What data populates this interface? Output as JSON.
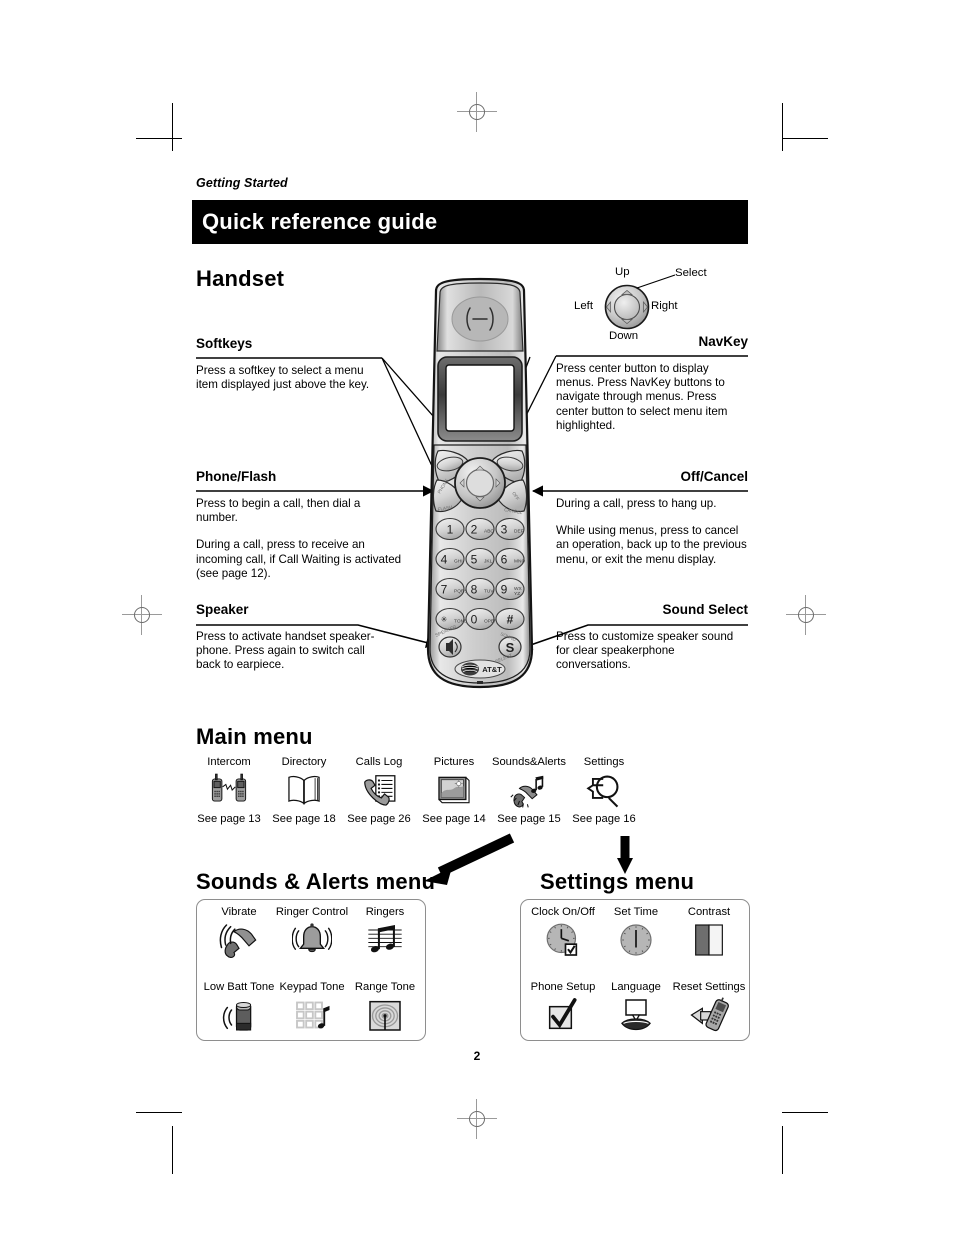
{
  "page": {
    "running_head": "Getting Started",
    "title": "Quick reference guide",
    "folio": "2"
  },
  "sections": {
    "handset_title": "Handset",
    "main_menu_title": "Main menu",
    "sounds_menu_title": "Sounds & Alerts menu",
    "settings_menu_title": "Settings menu"
  },
  "navkey": {
    "up": "Up",
    "down": "Down",
    "left": "Left",
    "right": "Right",
    "select": "Select",
    "name": "NavKey"
  },
  "callouts": {
    "softkeys": {
      "heading": "Softkeys",
      "p1": "Press a softkey to select a menu item displayed just above the key."
    },
    "navkey": {
      "heading": "NavKey",
      "p1": "Press center button to display menus. Press NavKey buttons to navigate through menus. Press center button to select menu item highlighted."
    },
    "phone_flash": {
      "heading": "Phone/Flash",
      "p1": "Press to begin a call, then dial a number.",
      "p2": "During a call, press to receive an incoming call, if Call Waiting is activated (see page 12)."
    },
    "off_cancel": {
      "heading": "Off/Cancel",
      "p1": "During a call, press to hang up.",
      "p2": "While using menus, press to cancel an operation, back up to the previous menu, or exit the menu display."
    },
    "speaker": {
      "heading": "Speaker",
      "p1": "Press to activate handset speaker-phone. Press again to switch call back to earpiece."
    },
    "sound_select": {
      "heading": "Sound Select",
      "p1": "Press to customize speaker sound for clear speakerphone conversations."
    }
  },
  "main_menu_items": [
    {
      "label": "Intercom",
      "ref": "See page 13",
      "icon": "intercom-icon"
    },
    {
      "label": "Directory",
      "ref": "See page 18",
      "icon": "directory-icon"
    },
    {
      "label": "Calls Log",
      "ref": "See page 26",
      "icon": "calls-log-icon"
    },
    {
      "label": "Pictures",
      "ref": "See page 14",
      "icon": "pictures-icon"
    },
    {
      "label": "Sounds&Alerts",
      "ref": "See page 15",
      "icon": "sounds-alerts-icon"
    },
    {
      "label": "Settings",
      "ref": "See page 16",
      "icon": "settings-icon"
    }
  ],
  "sounds_menu_items": [
    {
      "label": "Vibrate",
      "icon": "vibrate-icon"
    },
    {
      "label": "Ringer Control",
      "icon": "ringer-control-icon"
    },
    {
      "label": "Ringers",
      "icon": "ringers-icon"
    },
    {
      "label": "Low Batt Tone",
      "icon": "low-battery-tone-icon"
    },
    {
      "label": "Keypad Tone",
      "icon": "keypad-tone-icon"
    },
    {
      "label": "Range Tone",
      "icon": "range-tone-icon"
    }
  ],
  "settings_menu_items": [
    {
      "label": "Clock On/Off",
      "icon": "clock-on-off-icon"
    },
    {
      "label": "Set Time",
      "icon": "set-time-icon"
    },
    {
      "label": "Contrast",
      "icon": "contrast-icon"
    },
    {
      "label": "Phone Setup",
      "icon": "phone-setup-icon"
    },
    {
      "label": "Language",
      "icon": "language-icon"
    },
    {
      "label": "Reset Settings",
      "icon": "reset-settings-icon"
    }
  ],
  "handset_keypad": [
    {
      "digit": "1",
      "letters": ""
    },
    {
      "digit": "2",
      "letters": "ABC"
    },
    {
      "digit": "3",
      "letters": "DEF"
    },
    {
      "digit": "4",
      "letters": "GHI"
    },
    {
      "digit": "5",
      "letters": "JKL"
    },
    {
      "digit": "6",
      "letters": "MNO"
    },
    {
      "digit": "7",
      "letters": "PQRS"
    },
    {
      "digit": "8",
      "letters": "TUV"
    },
    {
      "digit": "9",
      "letters": "WXYZ"
    },
    {
      "digit": "*",
      "letters": "TONE"
    },
    {
      "digit": "0",
      "letters": "OPER"
    },
    {
      "digit": "#",
      "letters": ""
    }
  ],
  "handset_brand": "AT&T",
  "handset_key_labels": {
    "phone_flash": "PHONE FLASH",
    "off_cancel": "OFF CANCEL",
    "speaker": "SPEAKER",
    "sound_select": "SOUND SELECT",
    "sound_select_glyph": "S"
  },
  "colors": {
    "title_bar": "#000000",
    "menu_box_border": "#8e8e8e",
    "handset_body": "#c8c8c8",
    "handset_dark": "#5a5a5a"
  }
}
